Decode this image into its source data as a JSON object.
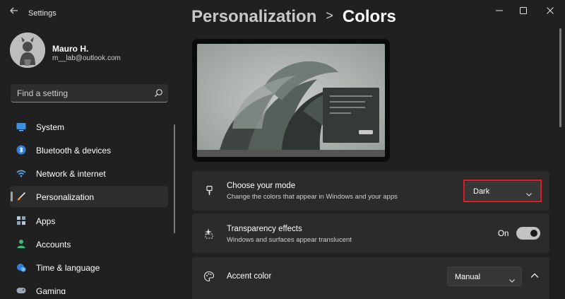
{
  "window": {
    "app_title": "Settings",
    "back_icon": "back-arrow-icon",
    "controls": [
      "minimize-icon",
      "maximize-icon",
      "close-icon"
    ]
  },
  "user": {
    "name": "Mauro H.",
    "email": "m__lab@outlook.com"
  },
  "search": {
    "placeholder": "Find a setting",
    "icon": "search-icon"
  },
  "sidebar": {
    "items": [
      {
        "label": "System",
        "icon": "monitor-icon",
        "active": false
      },
      {
        "label": "Bluetooth & devices",
        "icon": "bluetooth-icon",
        "active": false
      },
      {
        "label": "Network & internet",
        "icon": "wifi-icon",
        "active": false
      },
      {
        "label": "Personalization",
        "icon": "brush-icon",
        "active": true
      },
      {
        "label": "Apps",
        "icon": "apps-grid-icon",
        "active": false
      },
      {
        "label": "Accounts",
        "icon": "person-icon",
        "active": false
      },
      {
        "label": "Time & language",
        "icon": "globe-clock-icon",
        "active": false
      },
      {
        "label": "Gaming",
        "icon": "gamepad-icon",
        "active": false
      }
    ]
  },
  "header": {
    "parent": "Personalization",
    "separator": ">",
    "current": "Colors"
  },
  "settings": {
    "mode": {
      "title": "Choose your mode",
      "description": "Change the colors that appear in Windows and your apps",
      "value": "Dark",
      "icon": "paintbrush-icon"
    },
    "transparency": {
      "title": "Transparency effects",
      "description": "Windows and surfaces appear translucent",
      "state_label": "On",
      "enabled": true,
      "icon": "sparkle-icon"
    },
    "accent": {
      "title": "Accent color",
      "value": "Manual",
      "icon": "palette-icon",
      "expanded": true
    }
  },
  "colors": {
    "background": "#202020",
    "card": "#2b2b2b",
    "highlight": "#e01e26",
    "accent_blue": "#2f7fd6",
    "toggle_on": "#c2c2c2"
  }
}
